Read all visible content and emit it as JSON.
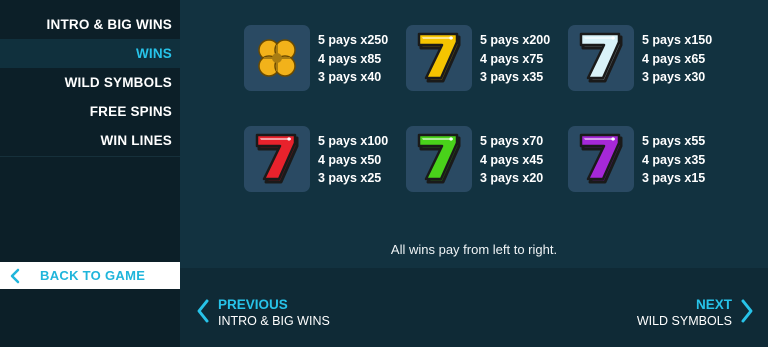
{
  "sidebar": {
    "menu": [
      {
        "label": "INTRO & BIG WINS",
        "active": false
      },
      {
        "label": "WINS",
        "active": true
      },
      {
        "label": "WILD SYMBOLS",
        "active": false
      },
      {
        "label": "FREE SPINS",
        "active": false
      },
      {
        "label": "WIN LINES",
        "active": false
      }
    ],
    "back_label": "BACK TO GAME",
    "back_icon": "chevron-left-icon"
  },
  "symbols": [
    {
      "name": "clover",
      "icon": "clover-icon",
      "color": "#f2b21a",
      "pays": [
        "5 pays x250",
        "4 pays x85",
        "3 pays x40"
      ]
    },
    {
      "name": "yellow seven",
      "icon": "seven-icon",
      "color": "#f5c400",
      "pays": [
        "5 pays x200",
        "4 pays x75",
        "3 pays x35"
      ]
    },
    {
      "name": "ice seven",
      "icon": "seven-icon",
      "color": "#d9f2f8",
      "pays": [
        "5 pays x150",
        "4 pays x65",
        "3 pays x30"
      ]
    },
    {
      "name": "red seven",
      "icon": "seven-icon",
      "color": "#e8222c",
      "pays": [
        "5 pays x100",
        "4 pays x50",
        "3 pays x25"
      ]
    },
    {
      "name": "green seven",
      "icon": "seven-icon",
      "color": "#49d21a",
      "pays": [
        "5 pays x70",
        "4 pays x45",
        "3 pays x20"
      ]
    },
    {
      "name": "purple seven",
      "icon": "seven-icon",
      "color": "#a628d8",
      "pays": [
        "5 pays x55",
        "4 pays x35",
        "3 pays x15"
      ]
    }
  ],
  "note": "All wins pay from left to right.",
  "nav": {
    "prev": {
      "title": "PREVIOUS",
      "subtitle": "INTRO & BIG WINS",
      "icon": "chevron-left-icon"
    },
    "next": {
      "title": "NEXT",
      "subtitle": "WILD SYMBOLS",
      "icon": "chevron-right-icon"
    }
  },
  "colors": {
    "accent": "#27c3e9",
    "background": "#0f2a36",
    "sidebar": "#0c1f28",
    "tile": "#2a4a63"
  }
}
